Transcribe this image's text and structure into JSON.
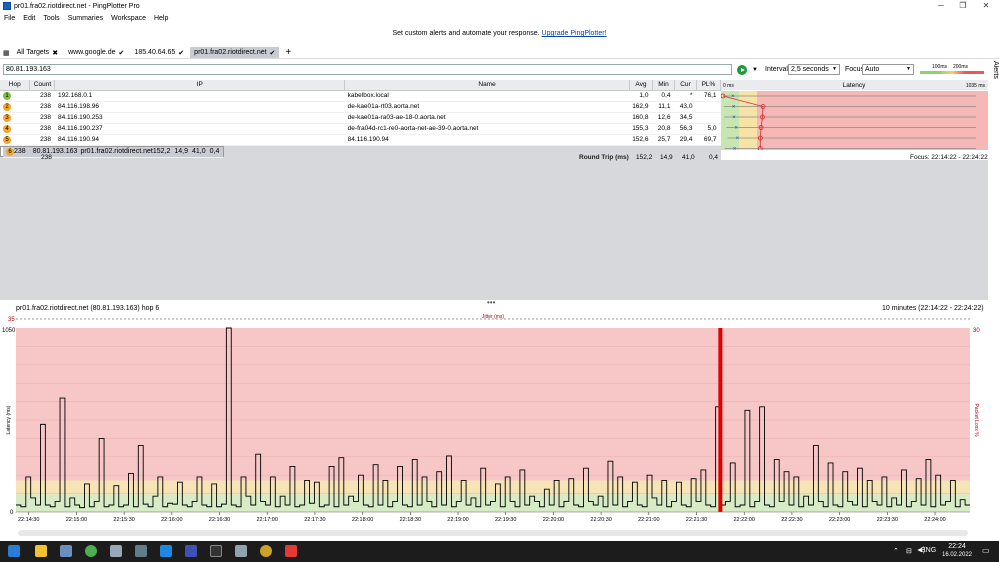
{
  "window": {
    "title": "pr01.fra02.riotdirect.net - PingPlotter Pro"
  },
  "menu": [
    "File",
    "Edit",
    "Tools",
    "Summaries",
    "Workspace",
    "Help"
  ],
  "banner": {
    "text": "Set custom alerts and automate your response.",
    "link": "Upgrade PingPlotter!"
  },
  "tabs": [
    {
      "label": "All Targets",
      "close": "✖"
    },
    {
      "label": "www.google.de",
      "close": "✔"
    },
    {
      "label": "185.40.64.65",
      "close": "✔"
    },
    {
      "label": "pr01.fra02.riotdirect.net",
      "close": "✔"
    }
  ],
  "toolbar": {
    "address": "80.81.193.163",
    "interval_label": "Interval",
    "interval_value": "2,5 seconds",
    "focus_label": "Focus",
    "focus_value": "Auto",
    "scale_low": "100ms",
    "scale_high": "200ms",
    "alerts": "Alerts"
  },
  "table": {
    "headers": [
      "Hop",
      "Count",
      "IP",
      "Name",
      "Avg",
      "Min",
      "Cur",
      "PL%",
      "Latency"
    ],
    "latency_min": "0 ms",
    "latency_max": "1035 ms",
    "rows": [
      {
        "hop": "1",
        "count": "238",
        "ip": "192.168.0.1",
        "name": "kabelbox.local",
        "avg": "1,0",
        "min": "0,4",
        "cur": "*",
        "pl": "76,1",
        "color": "#7cc242"
      },
      {
        "hop": "2",
        "count": "238",
        "ip": "84.116.198.96",
        "name": "de-kae01a-rt03.aorta.net",
        "avg": "162,9",
        "min": "11,1",
        "cur": "43,0",
        "pl": "",
        "color": "#f5a623"
      },
      {
        "hop": "3",
        "count": "238",
        "ip": "84.116.190.253",
        "name": "de-kae01a-ra03-ae-18-0.aorta.net",
        "avg": "160,8",
        "min": "12,6",
        "cur": "34,5",
        "pl": "",
        "color": "#f5a623"
      },
      {
        "hop": "4",
        "count": "238",
        "ip": "84.116.190.237",
        "name": "de-fra04d-rc1-re0-aorta-net-ae-39-0.aorta.net",
        "avg": "155,3",
        "min": "20,8",
        "cur": "56,3",
        "pl": "5,0",
        "color": "#f5a623"
      },
      {
        "hop": "5",
        "count": "238",
        "ip": "84.116.190.94",
        "name": "84.116.190.94",
        "avg": "152,6",
        "min": "25,7",
        "cur": "29,4",
        "pl": "69,7",
        "color": "#f5a623"
      },
      {
        "hop": "6",
        "count": "238",
        "ip": "80.81.193.163",
        "name": "pr01.fra02.riotdirect.net",
        "avg": "152,2",
        "min": "14,9",
        "cur": "41,0",
        "pl": "0,4",
        "color": "#f5a623"
      }
    ],
    "round_trip": {
      "count": "238",
      "label": "Round Trip (ms)",
      "avg": "152,2",
      "min": "14,9",
      "cur": "41,0",
      "pl": "0,4"
    },
    "focus_range": "Focus: 22:14:22 - 22:24:22"
  },
  "detail": {
    "title": "pr01.fra02.riotdirect.net (80.81.193.163) hop 6",
    "range": "10 minutes (22:14:22 - 22:24:22)",
    "jitter": "Jitter (ms)",
    "jitter_max": "35",
    "ylabel": "Latency (ms)",
    "ylabel_right": "Packet Loss %",
    "pl_max": "30"
  },
  "chart_data": {
    "type": "line",
    "ylim": [
      0,
      1050
    ],
    "ytick_labels": [
      "1050",
      "0"
    ],
    "xtick_labels": [
      "22:14:30",
      "22:15:00",
      "22:15:30",
      "22:16:00",
      "22:16:30",
      "22:17:00",
      "22:17:30",
      "22:18:00",
      "22:18:30",
      "22:19:00",
      "22:19:30",
      "22:20:00",
      "22:20:30",
      "22:21:00",
      "22:21:30",
      "22:22:00",
      "22:22:30",
      "22:23:00",
      "22:23:30",
      "22:24:00"
    ],
    "values": [
      40,
      30,
      200,
      80,
      40,
      500,
      40,
      30,
      60,
      650,
      30,
      80,
      40,
      25,
      160,
      30,
      60,
      420,
      30,
      40,
      150,
      30,
      40,
      220,
      30,
      380,
      45,
      30,
      90,
      200,
      30,
      50,
      45,
      170,
      40,
      30,
      60,
      200,
      40,
      30,
      160,
      30,
      45,
      1050,
      40,
      30,
      200,
      90,
      40,
      330,
      60,
      40,
      200,
      30,
      90,
      40,
      260,
      30,
      40,
      180,
      50,
      170,
      30,
      40,
      260,
      30,
      310,
      40,
      90,
      60,
      210,
      40,
      30,
      270,
      40,
      180,
      30,
      60,
      260,
      40,
      30,
      300,
      40,
      200,
      60,
      30,
      230,
      40,
      320,
      30,
      60,
      180,
      40,
      80,
      30,
      250,
      40,
      60,
      160,
      30,
      200,
      60,
      30,
      240,
      40,
      90,
      60,
      30,
      130,
      40,
      180,
      30,
      60,
      190,
      40,
      30,
      250,
      60,
      40,
      90,
      30,
      290,
      40,
      200,
      30,
      60,
      170,
      40,
      30,
      210,
      80,
      40,
      180,
      30,
      60,
      170,
      40,
      30,
      190,
      60,
      240,
      40,
      30,
      600,
      40,
      60,
      280,
      30,
      40,
      580,
      30,
      60,
      600,
      40,
      30,
      300,
      60,
      230,
      40,
      200,
      30,
      90,
      40,
      380,
      60,
      30,
      280,
      40,
      30,
      230,
      60,
      40,
      250,
      30,
      180,
      60,
      40,
      200,
      30,
      80,
      40,
      240,
      30,
      60,
      190,
      40,
      300,
      30,
      210,
      40,
      60,
      180,
      30,
      70,
      40
    ],
    "packet_loss_event": "22:21:45"
  },
  "taskbar": {
    "lang": "ENG",
    "time": "22:24",
    "date": "16.02.2022"
  }
}
